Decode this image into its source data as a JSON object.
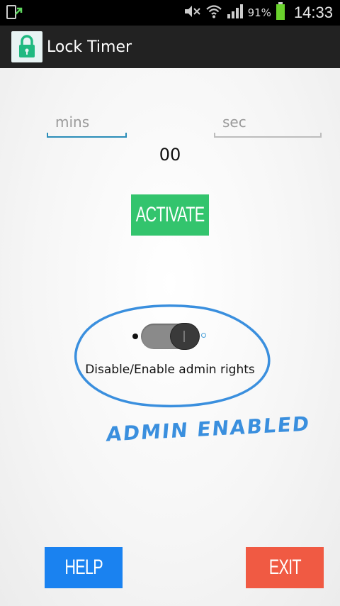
{
  "status_bar": {
    "battery_percent": "91%",
    "time": "14:33",
    "icons": [
      "download-notification-icon",
      "mute-icon",
      "wifi-icon",
      "signal-icon",
      "battery-icon"
    ]
  },
  "action_bar": {
    "title": "Lock Timer",
    "icon": "lock-icon"
  },
  "timer": {
    "mins_placeholder": "mins",
    "sec_placeholder": "sec",
    "counter": "00"
  },
  "buttons": {
    "activate": "ACTIVATE",
    "help": "HELP",
    "exit": "EXIT"
  },
  "admin": {
    "label": "Disable/Enable admin rights",
    "toggle_on": true,
    "annotation": "ADMIN ENABLED"
  },
  "colors": {
    "activate": "#33c46d",
    "help": "#1a82f0",
    "exit": "#f05a43",
    "annotation": "#3a8fde",
    "field_focus": "#2b8db8"
  }
}
